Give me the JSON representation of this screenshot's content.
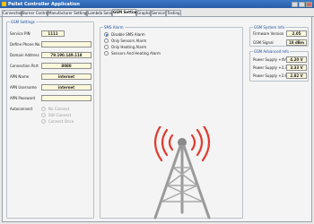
{
  "window": {
    "title": "Pellet Controller Application"
  },
  "tabs": [
    {
      "label": "Connection"
    },
    {
      "label": "Burner Control"
    },
    {
      "label": "Manufacturer Settings"
    },
    {
      "label": "Lambda Sensor"
    },
    {
      "label": "GSM Settings"
    },
    {
      "label": "Graphs"
    },
    {
      "label": "Service"
    },
    {
      "label": "Testing"
    }
  ],
  "gsm_settings": {
    "title": "GSM Settings",
    "fields": [
      {
        "label": "Service PIN",
        "value": "1111"
      },
      {
        "label": "Define Phone No",
        "value": ""
      },
      {
        "label": "Domain Address",
        "value": "79.190.149.118"
      },
      {
        "label": "Connection Port",
        "value": "8080"
      },
      {
        "label": "APN Name",
        "value": "internet"
      },
      {
        "label": "APN Username",
        "value": "internet"
      },
      {
        "label": "APN Password",
        "value": ""
      }
    ],
    "autoconnect": {
      "label": "Autoconnect",
      "options": [
        {
          "label": "No Connect",
          "selected": false
        },
        {
          "label": "Still Connect",
          "selected": false
        },
        {
          "label": "Connect Once",
          "selected": false
        }
      ]
    }
  },
  "sms_alarm": {
    "title": "SMS Alarm",
    "options": [
      {
        "label": "Disable SMS Alarm",
        "selected": true
      },
      {
        "label": "Only Sensors Alarm",
        "selected": false
      },
      {
        "label": "Only Heating Alarm",
        "selected": false
      },
      {
        "label": "Sensors And Heating Alarm",
        "selected": false
      }
    ]
  },
  "gsm_system_info": {
    "title": "GSM System Info",
    "items": [
      {
        "label": "Firmware Version",
        "value": "2.05"
      },
      {
        "label": "GSM Signal",
        "value": "18 dBm"
      }
    ]
  },
  "gsm_advanced_info": {
    "title": "GSM Advanced Info",
    "items": [
      {
        "label": "Power Supply +4V",
        "value": "4.20 V"
      },
      {
        "label": "Power Supply +3.3V",
        "value": "3.33 V"
      },
      {
        "label": "Power Supply +2.8V",
        "value": "2.82 V"
      }
    ]
  },
  "colors": {
    "title_bar": "#2a5ea6",
    "group_title": "#1b4fa0",
    "value_field": "#fbf8dc",
    "tower": "#9a9a9a",
    "signal_waves": "#e03a2f"
  },
  "icons": {
    "illustration": "signal-tower-icon"
  }
}
